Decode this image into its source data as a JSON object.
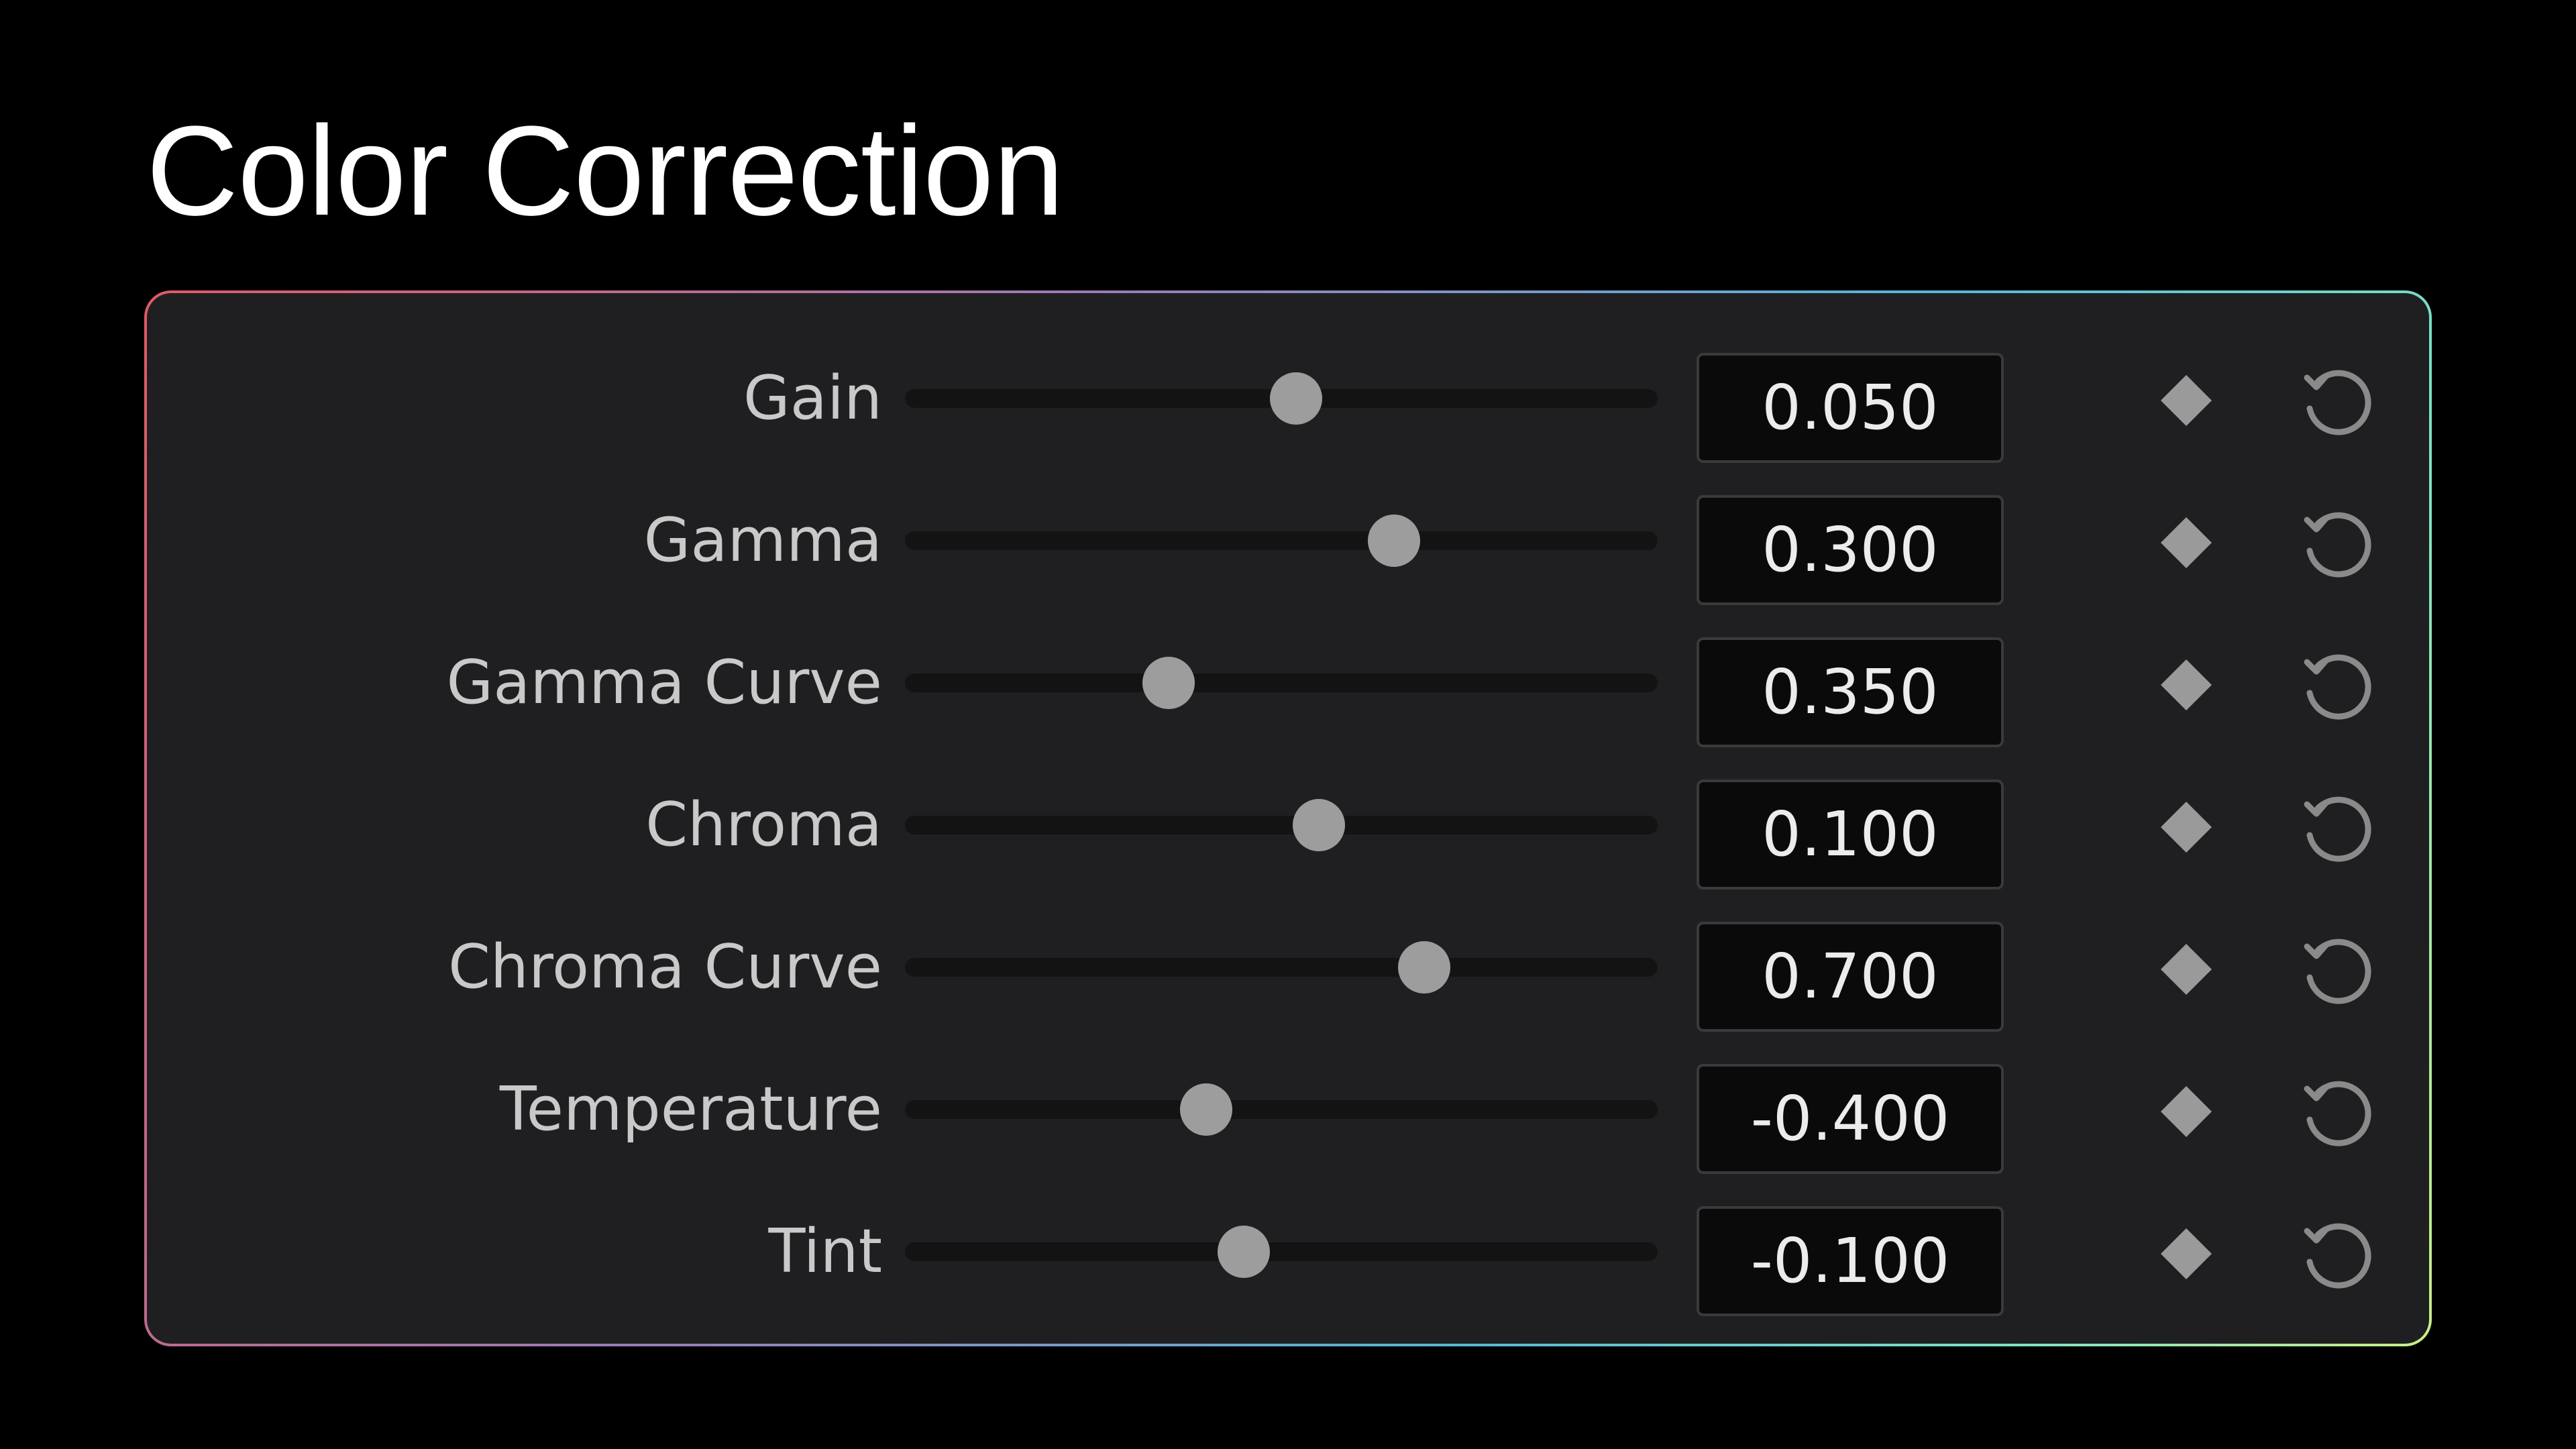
{
  "title": "Color Correction",
  "controls": [
    {
      "label": "Gain",
      "value": "0.050",
      "slider_fraction": 0.52
    },
    {
      "label": "Gamma",
      "value": "0.300",
      "slider_fraction": 0.65
    },
    {
      "label": "Gamma Curve",
      "value": "0.350",
      "slider_fraction": 0.35
    },
    {
      "label": "Chroma",
      "value": "0.100",
      "slider_fraction": 0.55
    },
    {
      "label": "Chroma Curve",
      "value": "0.700",
      "slider_fraction": 0.69
    },
    {
      "label": "Temperature",
      "value": "-0.400",
      "slider_fraction": 0.4
    },
    {
      "label": "Tint",
      "value": "-0.100",
      "slider_fraction": 0.45
    }
  ],
  "colors": {
    "background": "#000000",
    "panel": "#1f1f21",
    "knob": "#9d9d9d",
    "text": "#c9c9c9"
  },
  "icons": {
    "keyframe": "diamond-icon",
    "reset": "reset-icon"
  }
}
